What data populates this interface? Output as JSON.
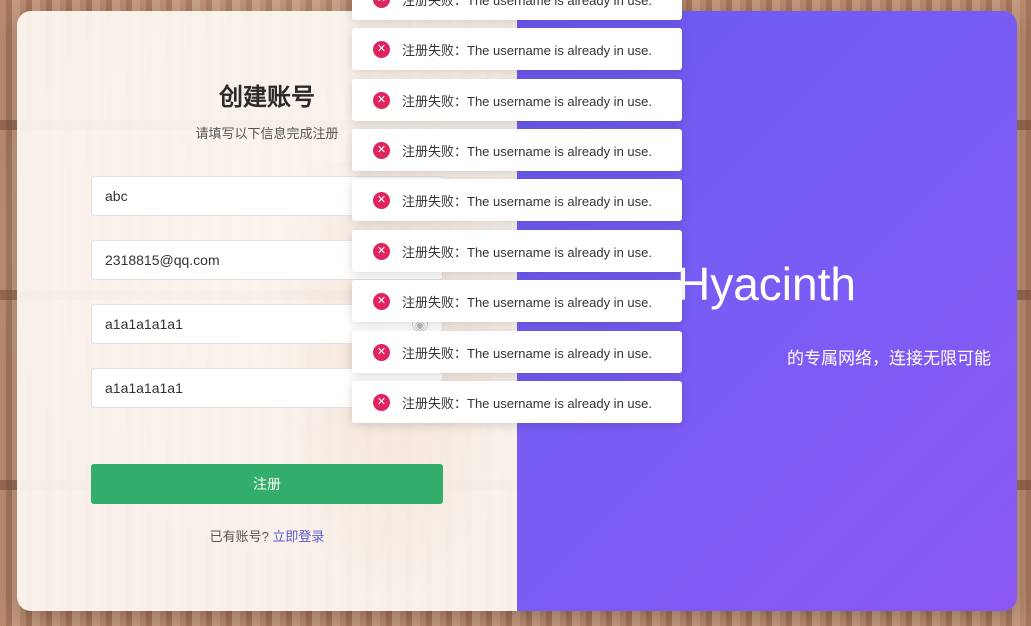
{
  "register": {
    "title": "创建账号",
    "subtitle": "请填写以下信息完成注册",
    "fields": [
      {
        "value": "abc"
      },
      {
        "value": "2318815@qq.com"
      },
      {
        "value": "a1a1a1a1a1"
      },
      {
        "value": "a1a1a1a1a1"
      }
    ],
    "submit_label": "注册",
    "have_account": "已有账号?",
    "login_link": "立即登录"
  },
  "brand": {
    "name": "Hyacinth",
    "slogan": "的专属网络，连接无限可能"
  },
  "toasts": [
    {
      "text": "注册失败：The username is already in use."
    },
    {
      "text": "注册失败：The username is already in use."
    },
    {
      "text": "注册失败：The username is already in use."
    },
    {
      "text": "注册失败：The username is already in use."
    },
    {
      "text": "注册失败：The username is already in use."
    },
    {
      "text": "注册失败：The username is already in use."
    },
    {
      "text": "注册失败：The username is already in use."
    },
    {
      "text": "注册失败：The username is already in use."
    },
    {
      "text": "注册失败：The username is already in use."
    }
  ],
  "colors": {
    "accent_green": "#33ad6a",
    "brand_purple": "#7b5cf5",
    "error_red": "#e0245e",
    "link": "#5b5bd6"
  },
  "icons": {
    "toast": "error-circle-icon",
    "password_toggle": "eye-icon"
  }
}
